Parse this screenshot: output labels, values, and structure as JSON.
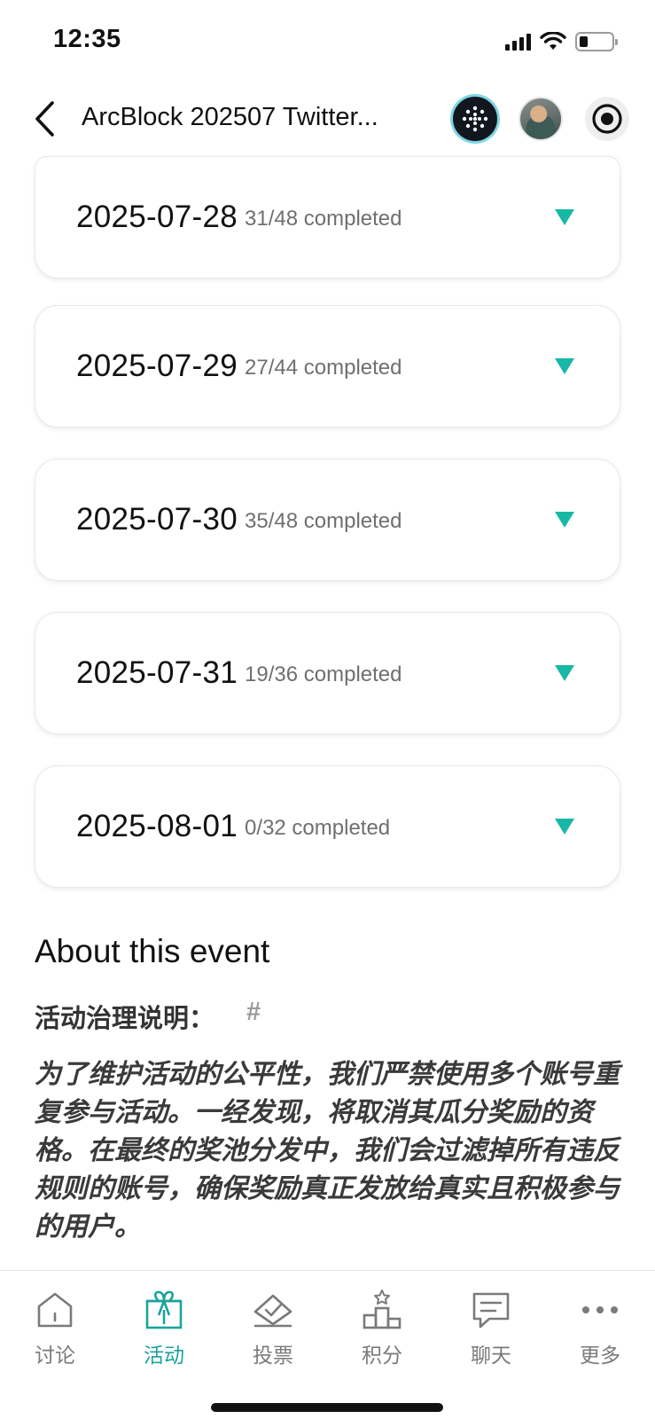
{
  "status_bar": {
    "time": "12:35"
  },
  "header": {
    "title": "ArcBlock 202507 Twitter..."
  },
  "days": [
    {
      "date": "2025-07-28",
      "progress": "31/48 completed"
    },
    {
      "date": "2025-07-29",
      "progress": "27/44 completed"
    },
    {
      "date": "2025-07-30",
      "progress": "35/48 completed"
    },
    {
      "date": "2025-07-31",
      "progress": "19/36 completed"
    },
    {
      "date": "2025-08-01",
      "progress": "0/32 completed"
    }
  ],
  "about": {
    "title": "About this event",
    "governance_label": "活动治理说明：",
    "hash": "#",
    "governance_text": "为了维护活动的公平性，我们严禁使用多个账号重复参与活动。一经发现，将取消其瓜分奖励的资格。在最终的奖池分发中，我们会过滤掉所有违反规则的账号，确保奖励真正发放给真实且积极参与的用户。"
  },
  "nav": {
    "items": [
      {
        "label": "讨论",
        "icon": "home-icon"
      },
      {
        "label": "活动",
        "icon": "gift-icon",
        "active": true
      },
      {
        "label": "投票",
        "icon": "vote-icon"
      },
      {
        "label": "积分",
        "icon": "leaderboard-icon"
      },
      {
        "label": "聊天",
        "icon": "chat-icon"
      },
      {
        "label": "更多",
        "icon": "more-icon"
      }
    ]
  },
  "colors": {
    "accent": "#1ba39c",
    "caret": "#17b8a6",
    "muted_text": "#6f6f6f"
  }
}
